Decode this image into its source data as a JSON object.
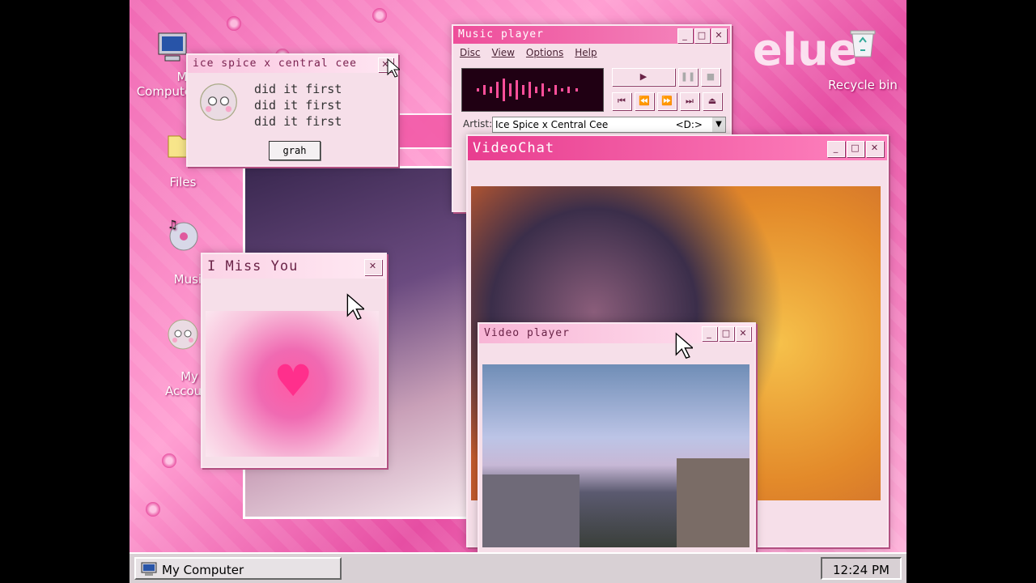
{
  "desktop": {
    "icons": [
      {
        "label": "My Computer",
        "icon": "computer-icon"
      },
      {
        "label": "Files",
        "icon": "folder-icon"
      },
      {
        "label": "Music",
        "icon": "music-cd-icon"
      },
      {
        "label": "My Account",
        "icon": "avatar-icon"
      },
      {
        "label": "Recycle bin",
        "icon": "recycle-bin-icon"
      }
    ],
    "wallpaper_text": "elue"
  },
  "msg_window": {
    "title": "ice spice x central cee",
    "lines": [
      "did it first",
      "did it first",
      "did it first"
    ],
    "button": "grah"
  },
  "music_player": {
    "title": "Music player",
    "menu": [
      "Disc",
      "View",
      "Options",
      "Help"
    ],
    "artist_label": "Artist:",
    "artist": "Ice Spice x Central Cee",
    "drive": "<D:>"
  },
  "videochat": {
    "title": "VideoChat"
  },
  "imissyou": {
    "title": "I Miss You"
  },
  "video_player": {
    "title": "Video player"
  },
  "taskbar": {
    "start_label": "My Computer",
    "time": "12:24 PM"
  },
  "colors": {
    "accent": "#e83d8f",
    "window_bg": "#f6dfe9",
    "taskbar": "#d8d0d4"
  }
}
